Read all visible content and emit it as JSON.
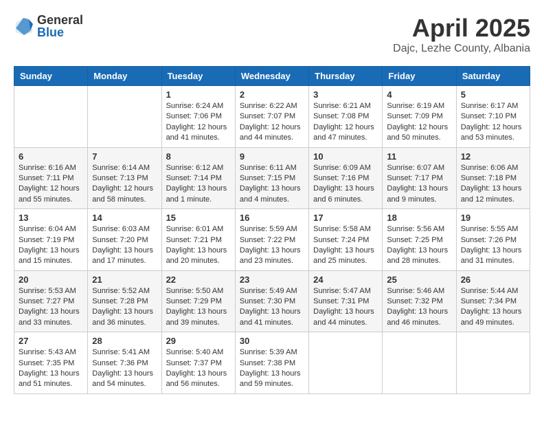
{
  "header": {
    "logo_general": "General",
    "logo_blue": "Blue",
    "month": "April 2025",
    "location": "Dajc, Lezhe County, Albania"
  },
  "days_of_week": [
    "Sunday",
    "Monday",
    "Tuesday",
    "Wednesday",
    "Thursday",
    "Friday",
    "Saturday"
  ],
  "weeks": [
    [
      {
        "day": "",
        "info": ""
      },
      {
        "day": "",
        "info": ""
      },
      {
        "day": "1",
        "info": "Sunrise: 6:24 AM\nSunset: 7:06 PM\nDaylight: 12 hours and 41 minutes."
      },
      {
        "day": "2",
        "info": "Sunrise: 6:22 AM\nSunset: 7:07 PM\nDaylight: 12 hours and 44 minutes."
      },
      {
        "day": "3",
        "info": "Sunrise: 6:21 AM\nSunset: 7:08 PM\nDaylight: 12 hours and 47 minutes."
      },
      {
        "day": "4",
        "info": "Sunrise: 6:19 AM\nSunset: 7:09 PM\nDaylight: 12 hours and 50 minutes."
      },
      {
        "day": "5",
        "info": "Sunrise: 6:17 AM\nSunset: 7:10 PM\nDaylight: 12 hours and 53 minutes."
      }
    ],
    [
      {
        "day": "6",
        "info": "Sunrise: 6:16 AM\nSunset: 7:11 PM\nDaylight: 12 hours and 55 minutes."
      },
      {
        "day": "7",
        "info": "Sunrise: 6:14 AM\nSunset: 7:13 PM\nDaylight: 12 hours and 58 minutes."
      },
      {
        "day": "8",
        "info": "Sunrise: 6:12 AM\nSunset: 7:14 PM\nDaylight: 13 hours and 1 minute."
      },
      {
        "day": "9",
        "info": "Sunrise: 6:11 AM\nSunset: 7:15 PM\nDaylight: 13 hours and 4 minutes."
      },
      {
        "day": "10",
        "info": "Sunrise: 6:09 AM\nSunset: 7:16 PM\nDaylight: 13 hours and 6 minutes."
      },
      {
        "day": "11",
        "info": "Sunrise: 6:07 AM\nSunset: 7:17 PM\nDaylight: 13 hours and 9 minutes."
      },
      {
        "day": "12",
        "info": "Sunrise: 6:06 AM\nSunset: 7:18 PM\nDaylight: 13 hours and 12 minutes."
      }
    ],
    [
      {
        "day": "13",
        "info": "Sunrise: 6:04 AM\nSunset: 7:19 PM\nDaylight: 13 hours and 15 minutes."
      },
      {
        "day": "14",
        "info": "Sunrise: 6:03 AM\nSunset: 7:20 PM\nDaylight: 13 hours and 17 minutes."
      },
      {
        "day": "15",
        "info": "Sunrise: 6:01 AM\nSunset: 7:21 PM\nDaylight: 13 hours and 20 minutes."
      },
      {
        "day": "16",
        "info": "Sunrise: 5:59 AM\nSunset: 7:22 PM\nDaylight: 13 hours and 23 minutes."
      },
      {
        "day": "17",
        "info": "Sunrise: 5:58 AM\nSunset: 7:24 PM\nDaylight: 13 hours and 25 minutes."
      },
      {
        "day": "18",
        "info": "Sunrise: 5:56 AM\nSunset: 7:25 PM\nDaylight: 13 hours and 28 minutes."
      },
      {
        "day": "19",
        "info": "Sunrise: 5:55 AM\nSunset: 7:26 PM\nDaylight: 13 hours and 31 minutes."
      }
    ],
    [
      {
        "day": "20",
        "info": "Sunrise: 5:53 AM\nSunset: 7:27 PM\nDaylight: 13 hours and 33 minutes."
      },
      {
        "day": "21",
        "info": "Sunrise: 5:52 AM\nSunset: 7:28 PM\nDaylight: 13 hours and 36 minutes."
      },
      {
        "day": "22",
        "info": "Sunrise: 5:50 AM\nSunset: 7:29 PM\nDaylight: 13 hours and 39 minutes."
      },
      {
        "day": "23",
        "info": "Sunrise: 5:49 AM\nSunset: 7:30 PM\nDaylight: 13 hours and 41 minutes."
      },
      {
        "day": "24",
        "info": "Sunrise: 5:47 AM\nSunset: 7:31 PM\nDaylight: 13 hours and 44 minutes."
      },
      {
        "day": "25",
        "info": "Sunrise: 5:46 AM\nSunset: 7:32 PM\nDaylight: 13 hours and 46 minutes."
      },
      {
        "day": "26",
        "info": "Sunrise: 5:44 AM\nSunset: 7:34 PM\nDaylight: 13 hours and 49 minutes."
      }
    ],
    [
      {
        "day": "27",
        "info": "Sunrise: 5:43 AM\nSunset: 7:35 PM\nDaylight: 13 hours and 51 minutes."
      },
      {
        "day": "28",
        "info": "Sunrise: 5:41 AM\nSunset: 7:36 PM\nDaylight: 13 hours and 54 minutes."
      },
      {
        "day": "29",
        "info": "Sunrise: 5:40 AM\nSunset: 7:37 PM\nDaylight: 13 hours and 56 minutes."
      },
      {
        "day": "30",
        "info": "Sunrise: 5:39 AM\nSunset: 7:38 PM\nDaylight: 13 hours and 59 minutes."
      },
      {
        "day": "",
        "info": ""
      },
      {
        "day": "",
        "info": ""
      },
      {
        "day": "",
        "info": ""
      }
    ]
  ]
}
